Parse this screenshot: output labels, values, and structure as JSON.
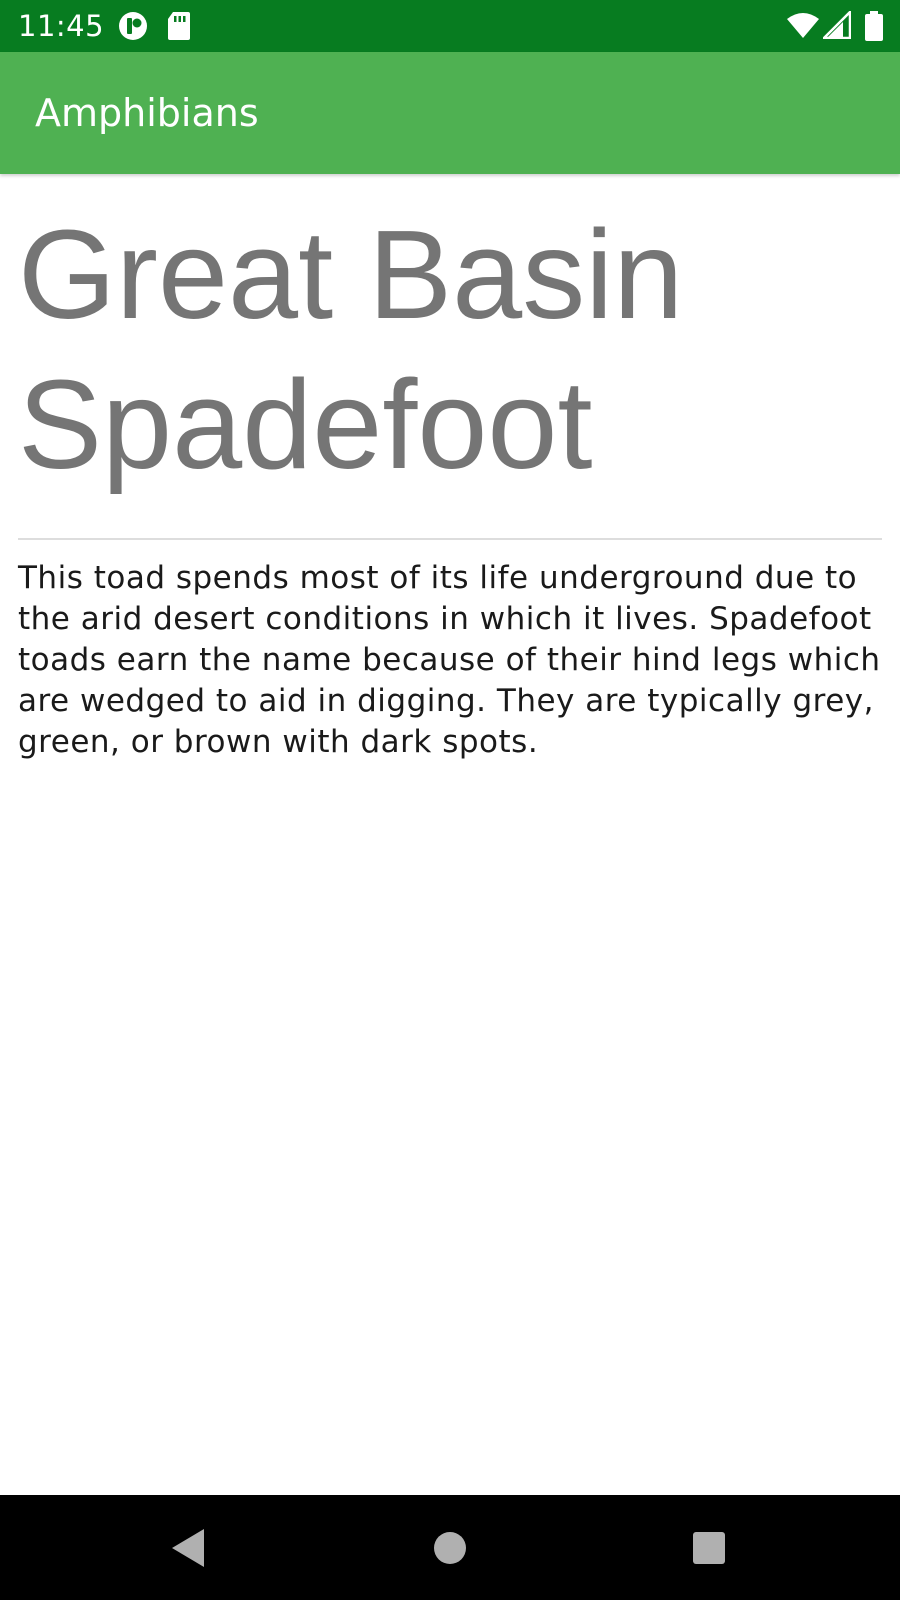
{
  "status_bar": {
    "time": "11:45",
    "icons": [
      "notification-app-icon",
      "sd-card-icon",
      "wifi-icon",
      "cell-signal-icon",
      "battery-icon"
    ],
    "background": "#077c20"
  },
  "app_bar": {
    "title": "Amphibians",
    "background": "#4fb152"
  },
  "detail": {
    "name": "Great Basin Spadefoot",
    "description": "This toad spends most of its life underground due to the arid desert conditions in which it lives. Spadefoot toads earn the name because of their hind legs which are wedged to aid in digging. They are typically grey, green, or brown with dark spots."
  },
  "nav_bar": {
    "buttons": [
      "back-icon",
      "home-icon",
      "recents-icon"
    ]
  }
}
